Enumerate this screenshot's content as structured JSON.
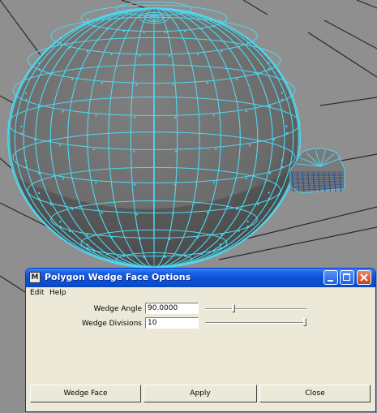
{
  "viewport": {
    "colors": {
      "background": "#8f8f8f",
      "grid": "#2a2a2a",
      "wireframe": "#4fd8f0",
      "sphere": "#6a6a6a"
    }
  },
  "dialog": {
    "title": "Polygon Wedge Face Options",
    "icon_text": "M",
    "title_buttons": {
      "minimize": "minimize-icon",
      "maximize": "maximize-icon",
      "close": "close-icon"
    },
    "menu": [
      "Edit",
      "Help"
    ],
    "fields": {
      "wedge_angle": {
        "label": "Wedge Angle",
        "value": "90.0000",
        "slider_fraction": 0.28
      },
      "wedge_divisions": {
        "label": "Wedge Divisions",
        "value": "10",
        "slider_fraction": 1.0
      }
    },
    "buttons": {
      "wedge_face": "Wedge Face",
      "apply": "Apply",
      "close": "Close"
    }
  }
}
